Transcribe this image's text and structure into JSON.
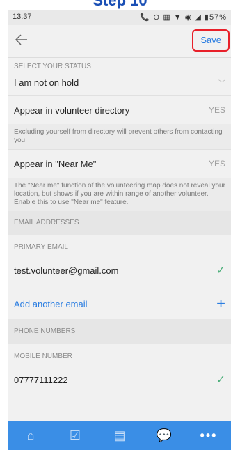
{
  "step_title": "Step 10",
  "status_bar": {
    "time": "13:37",
    "icons": "📞 ⊖ ▦ ▼ ◉ ◢ ▮57%"
  },
  "toolbar": {
    "back_icon": "arrow-left-icon",
    "save_label": "Save"
  },
  "status_section": {
    "label": "SELECT YOUR STATUS",
    "value": "I am not on hold"
  },
  "directory": {
    "label": "Appear in volunteer directory",
    "value": "YES",
    "caption": "Excluding yourself from directory will prevent others from contacting you."
  },
  "near_me": {
    "label": "Appear in \"Near Me\"",
    "value": "YES",
    "caption": "The \"Near me\" function of the volunteering map does not reveal your location, but shows if you are within range of another volunteer. Enable this to use \"Near me\" feature."
  },
  "email_section": {
    "header": "EMAIL ADDRESSES",
    "primary_label": "PRIMARY EMAIL",
    "primary_value": "test.volunteer@gmail.com",
    "add_label": "Add another email"
  },
  "phone_section": {
    "header": "PHONE NUMBERS",
    "mobile_label": "MOBILE NUMBER",
    "mobile_value": "07777111222"
  },
  "colors": {
    "accent": "#2a7de1",
    "nav": "#3a8ee6",
    "check": "#4caf7a",
    "highlight": "#e8202a"
  },
  "nav_icons": [
    "home-icon",
    "check-box-icon",
    "news-icon",
    "chat-icon",
    "more-icon"
  ],
  "nav_glyphs": {
    "home": "⌂",
    "check": "☑",
    "news": "▤",
    "chat": "💬",
    "more": "•••"
  }
}
